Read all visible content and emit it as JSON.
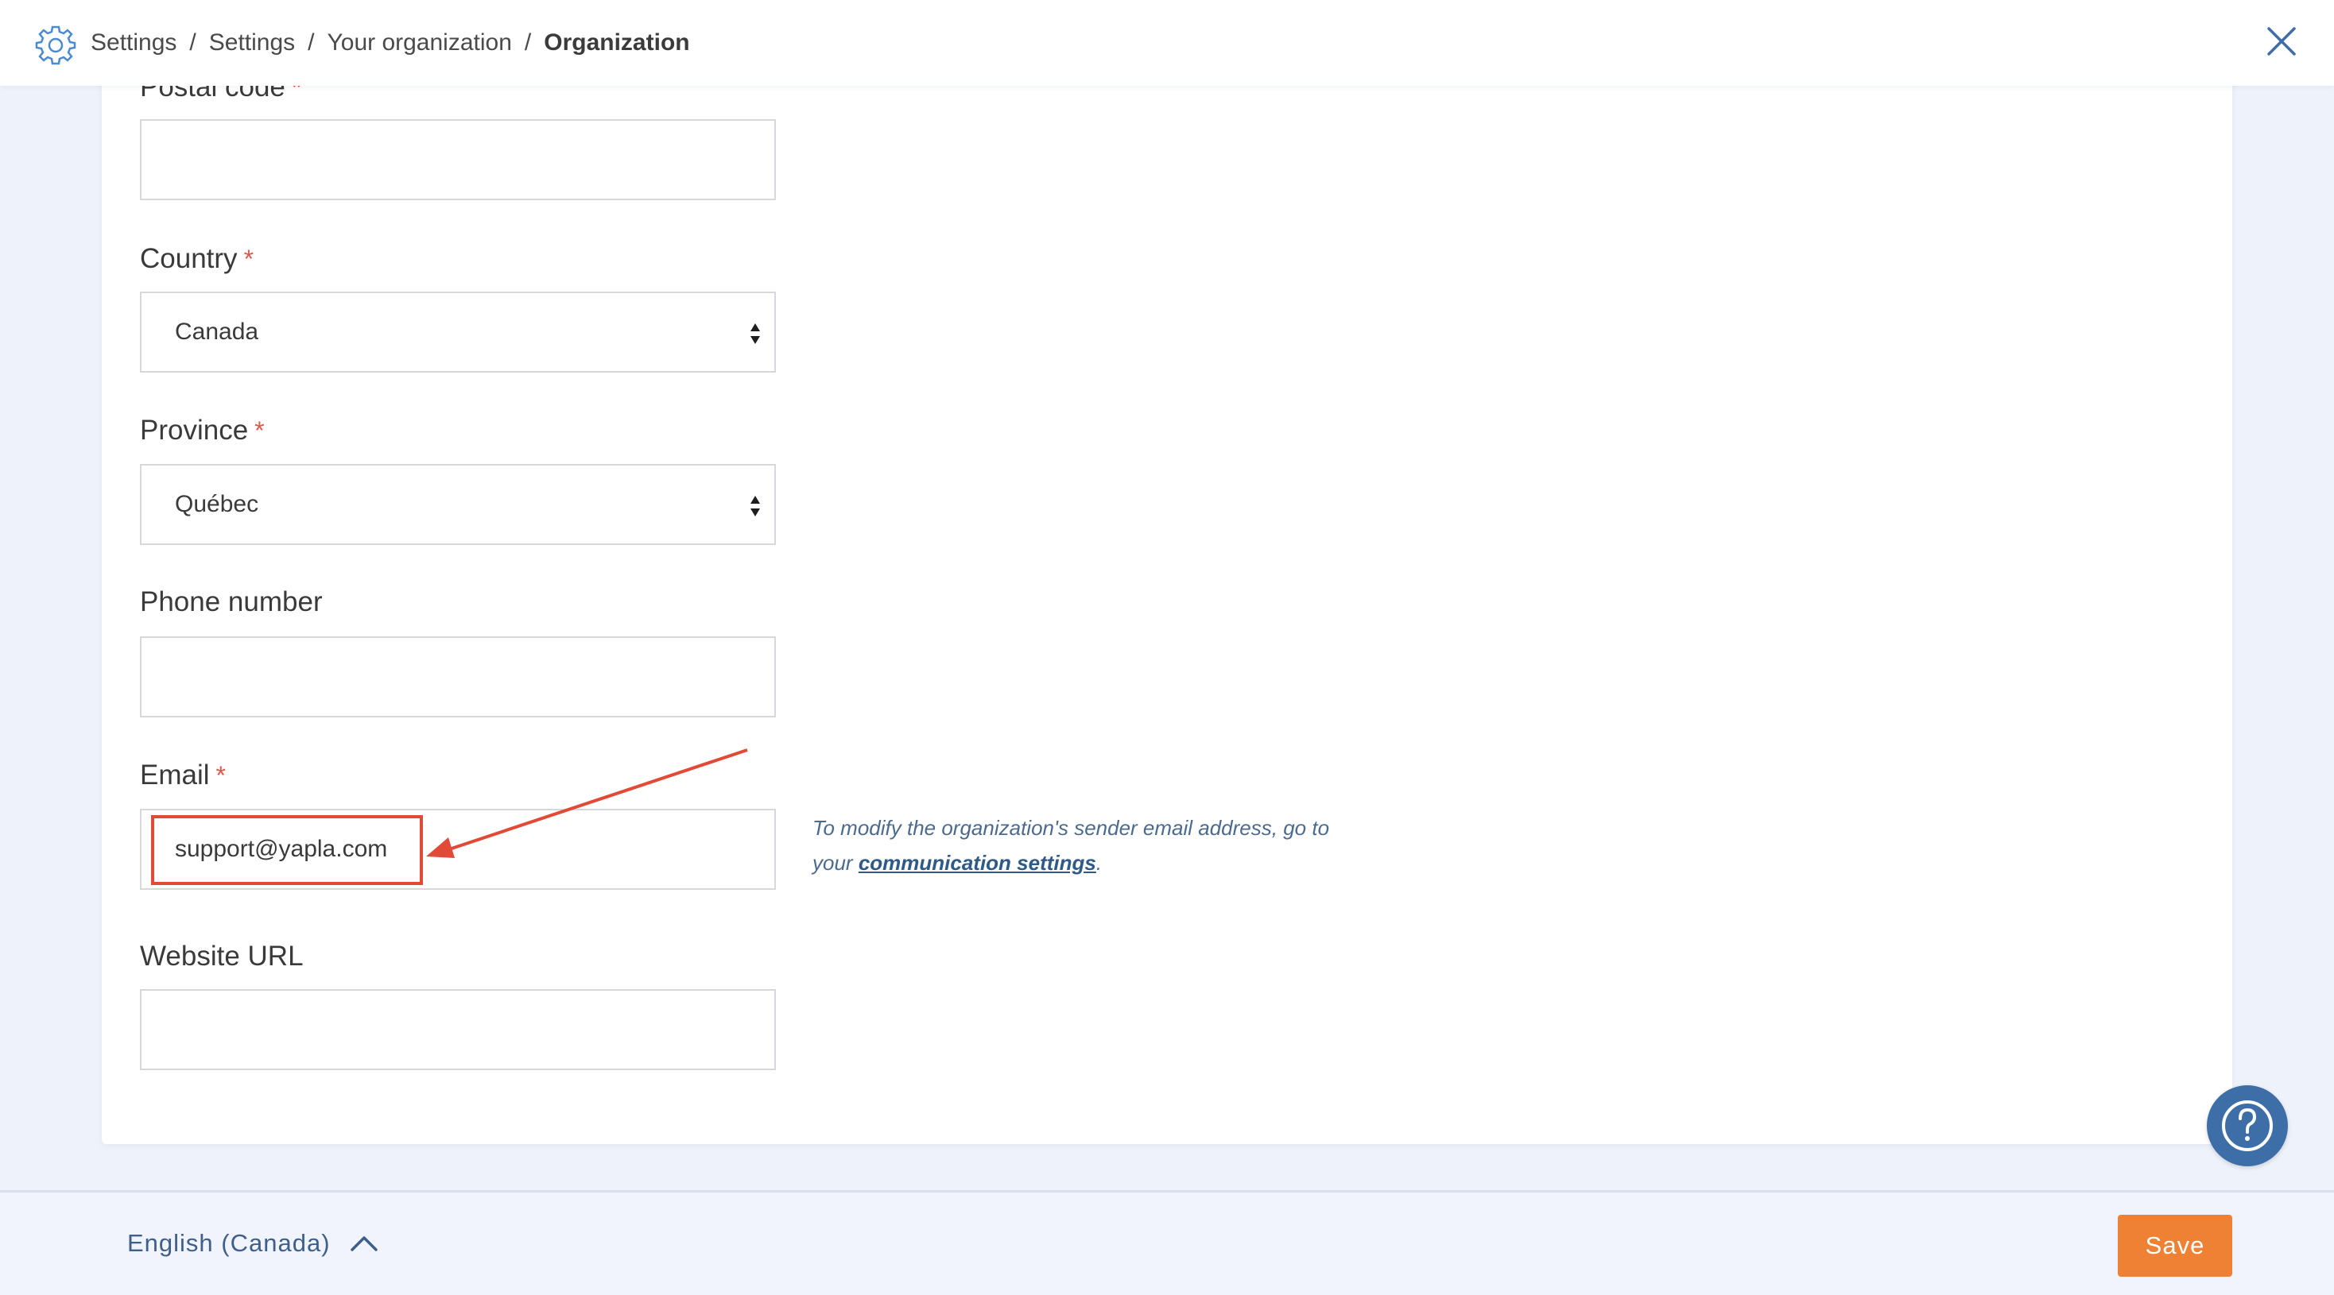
{
  "header": {
    "breadcrumb": [
      "Settings",
      "Settings",
      "Your organization",
      "Organization"
    ],
    "separator": "/"
  },
  "form": {
    "postal_code": {
      "label": "Postal code",
      "required_mark": "*",
      "value": ""
    },
    "country": {
      "label": "Country",
      "required_mark": "*",
      "selected": "Canada"
    },
    "province": {
      "label": "Province",
      "required_mark": "*",
      "selected": "Québec"
    },
    "phone": {
      "label": "Phone number",
      "value": ""
    },
    "email": {
      "label": "Email",
      "required_mark": "*",
      "value": "support@yapla.com"
    },
    "website": {
      "label": "Website URL",
      "value": ""
    }
  },
  "email_help": {
    "text_before": "To modify the organization's sender email address, go to your ",
    "link": "communication settings",
    "text_after": "."
  },
  "footer": {
    "language": "English (Canada)",
    "save_label": "Save"
  },
  "colors": {
    "accent": "#ee8134",
    "required": "#e0574a",
    "annotation": "#e04a36",
    "link": "#2f5a88",
    "help_fab": "#3e6ea8"
  },
  "icons": {
    "header": "gear-icon",
    "close": "close-icon",
    "select": "select-arrows-icon",
    "language_toggle": "chevron-up-icon",
    "help": "question-icon"
  }
}
